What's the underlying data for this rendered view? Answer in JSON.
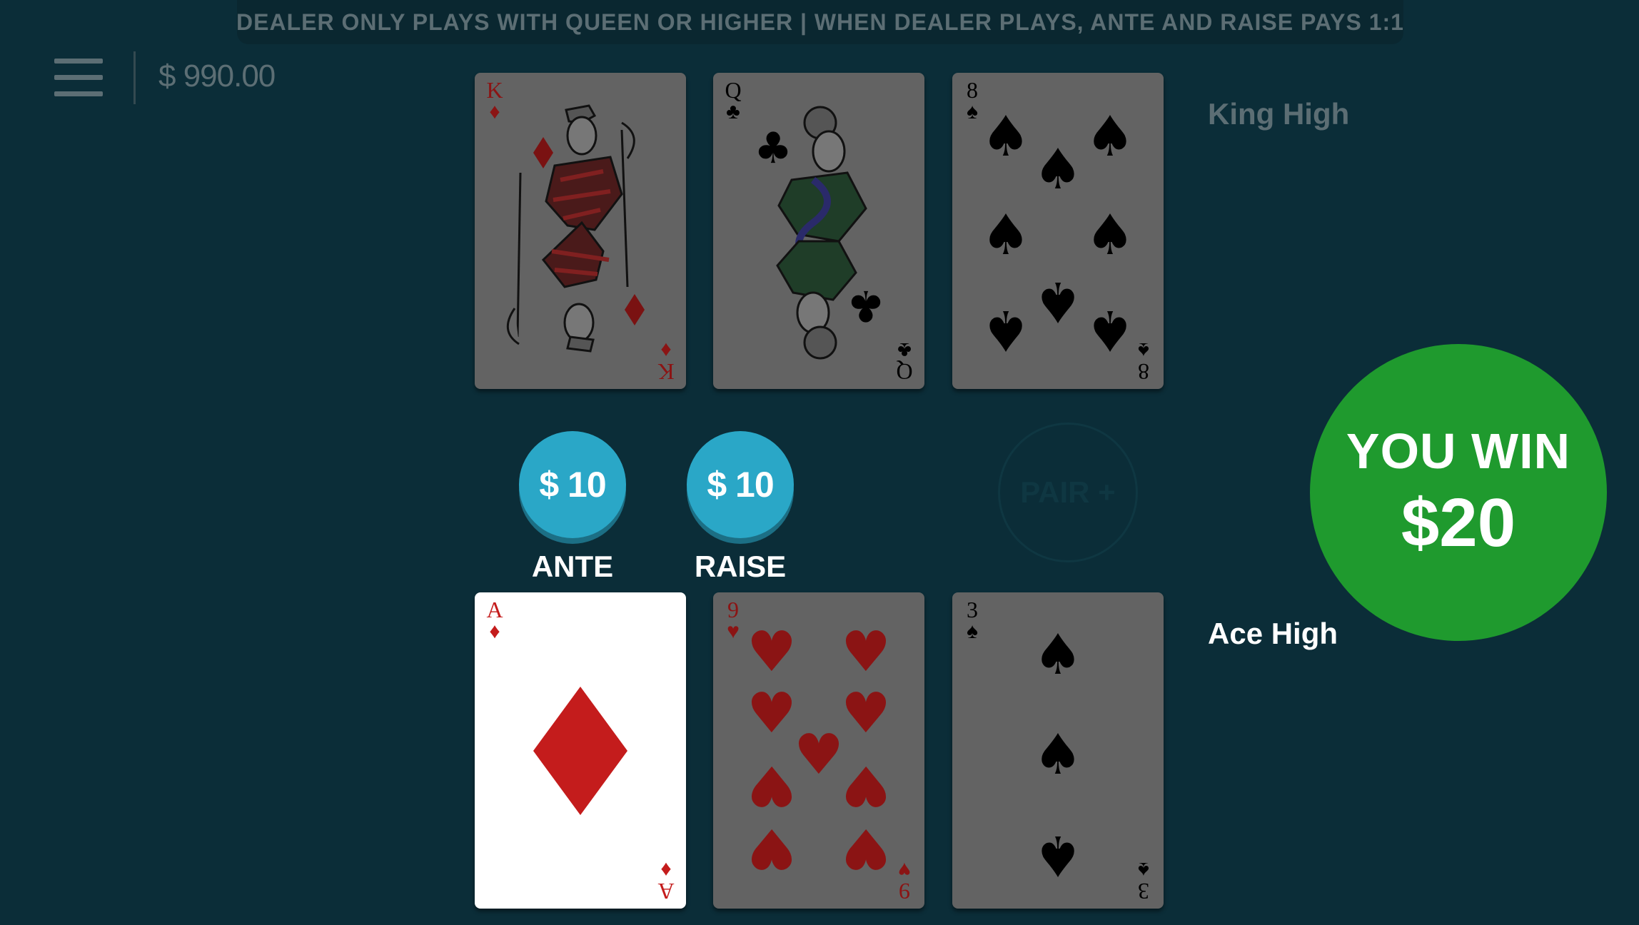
{
  "banner": "DEALER ONLY PLAYS WITH QUEEN OR HIGHER  |  WHEN DEALER PLAYS, ANTE AND RAISE PAYS 1:1",
  "balance": "$ 990.00",
  "dealer": {
    "hand_name": "King High",
    "cards": [
      {
        "rank": "K",
        "suit": "♦",
        "suit_name": "diamonds",
        "color": "red"
      },
      {
        "rank": "Q",
        "suit": "♣",
        "suit_name": "clubs",
        "color": "black"
      },
      {
        "rank": "8",
        "suit": "♠",
        "suit_name": "spades",
        "color": "black"
      }
    ]
  },
  "player": {
    "hand_name": "Ace High",
    "cards": [
      {
        "rank": "A",
        "suit": "♦",
        "suit_name": "diamonds",
        "color": "red"
      },
      {
        "rank": "9",
        "suit": "♥",
        "suit_name": "hearts",
        "color": "red"
      },
      {
        "rank": "3",
        "suit": "♠",
        "suit_name": "spades",
        "color": "black"
      }
    ]
  },
  "bets": {
    "ante": {
      "amount": "$ 10",
      "label": "ANTE"
    },
    "raise": {
      "amount": "$ 10",
      "label": "RAISE"
    },
    "pair_plus": {
      "label": "PAIR +"
    }
  },
  "result": {
    "title": "YOU WIN",
    "amount": "$20"
  },
  "colors": {
    "table": "#0b2d38",
    "chip": "#2aa7c7",
    "win": "#1f9a2e",
    "hand_name_dealer": "#5c6e74",
    "hand_name_player": "#ffffff"
  },
  "icons": {
    "menu": "hamburger-menu-icon"
  }
}
